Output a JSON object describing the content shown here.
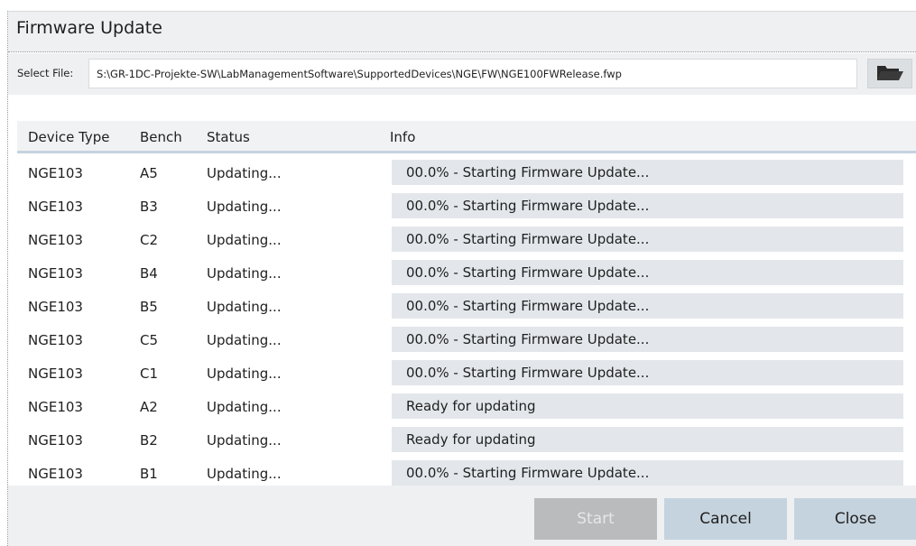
{
  "window": {
    "title": "Firmware Update"
  },
  "file": {
    "label": "Select File:",
    "path": "S:\\GR-1DC-Projekte-SW\\LabManagementSoftware\\SupportedDevices\\NGE\\FW\\NGE100FWRelease.fwp",
    "browse_icon": "folder-open-icon"
  },
  "table": {
    "columns": [
      "Device Type",
      "Bench",
      "Status",
      "Info"
    ],
    "rows": [
      {
        "device_type": "NGE103",
        "bench": "A5",
        "status": "Updating...",
        "info": "00.0% - Starting Firmware Update..."
      },
      {
        "device_type": "NGE103",
        "bench": "B3",
        "status": "Updating...",
        "info": "00.0% - Starting Firmware Update..."
      },
      {
        "device_type": "NGE103",
        "bench": "C2",
        "status": "Updating...",
        "info": "00.0% - Starting Firmware Update..."
      },
      {
        "device_type": "NGE103",
        "bench": "B4",
        "status": "Updating...",
        "info": "00.0% - Starting Firmware Update..."
      },
      {
        "device_type": "NGE103",
        "bench": "B5",
        "status": "Updating...",
        "info": "00.0% - Starting Firmware Update..."
      },
      {
        "device_type": "NGE103",
        "bench": "C5",
        "status": "Updating...",
        "info": "00.0% - Starting Firmware Update..."
      },
      {
        "device_type": "NGE103",
        "bench": "C1",
        "status": "Updating...",
        "info": "00.0% - Starting Firmware Update..."
      },
      {
        "device_type": "NGE103",
        "bench": "A2",
        "status": "Updating...",
        "info": "Ready for updating"
      },
      {
        "device_type": "NGE103",
        "bench": "B2",
        "status": "Updating...",
        "info": "Ready for updating"
      },
      {
        "device_type": "NGE103",
        "bench": "B1",
        "status": "Updating...",
        "info": "00.0% - Starting Firmware Update..."
      }
    ]
  },
  "buttons": {
    "start": "Start",
    "cancel": "Cancel",
    "close": "Close",
    "start_enabled": false
  },
  "colors": {
    "panel_bg": "#eef0f2",
    "info_box_bg": "#e3e7eb",
    "button_bg": "#c5d3de",
    "disabled_button_bg": "#b9bbbd"
  }
}
